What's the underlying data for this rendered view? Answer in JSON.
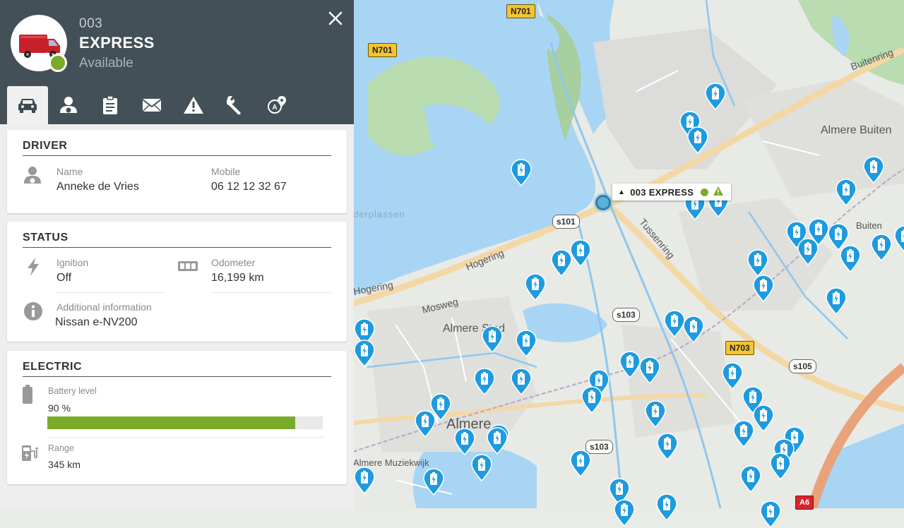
{
  "vehicle": {
    "id": "003",
    "name": "EXPRESS",
    "status": "Available",
    "status_color": "#7aaa2a"
  },
  "tabs": [
    {
      "icon": "car-icon",
      "active": true
    },
    {
      "icon": "driver-icon",
      "active": false
    },
    {
      "icon": "clipboard-icon",
      "active": false
    },
    {
      "icon": "envelope-icon",
      "active": false
    },
    {
      "icon": "warning-icon",
      "active": false
    },
    {
      "icon": "wrench-icon",
      "active": false
    },
    {
      "icon": "address-pin-icon",
      "active": false
    }
  ],
  "driver": {
    "title": "DRIVER",
    "name_label": "Name",
    "name_value": "Anneke de Vries",
    "mobile_label": "Mobile",
    "mobile_value": "06 12 12 32 67"
  },
  "status": {
    "title": "STATUS",
    "ignition_label": "Ignition",
    "ignition_value": "Off",
    "odometer_label": "Odometer",
    "odometer_value": "16,199 km",
    "additional_label": "Additional information",
    "additional_value": "Nissan e-NV200"
  },
  "electric": {
    "title": "ELECTRIC",
    "battery_label": "Battery level",
    "battery_value": "90 %",
    "battery_fraction": 0.9,
    "battery_color": "#7aaa2a",
    "range_label": "Range",
    "range_value": "345 km"
  },
  "map": {
    "callout_label": "003 EXPRESS",
    "road_shields": [
      "N701",
      "N701",
      "s101",
      "s103",
      "N703",
      "s105",
      "s103",
      "A6"
    ],
    "street_labels": [
      "Buitenring",
      "Almere Buiten",
      "Tussenring",
      "Hogering",
      "Hogering",
      "Mosweg",
      "Almere Stad",
      "Almere",
      "Almere Muziekwijk",
      "Buiten",
      "derplassen"
    ],
    "pin_icon": "charging-station-icon",
    "pin_color": "#1e9be0"
  }
}
